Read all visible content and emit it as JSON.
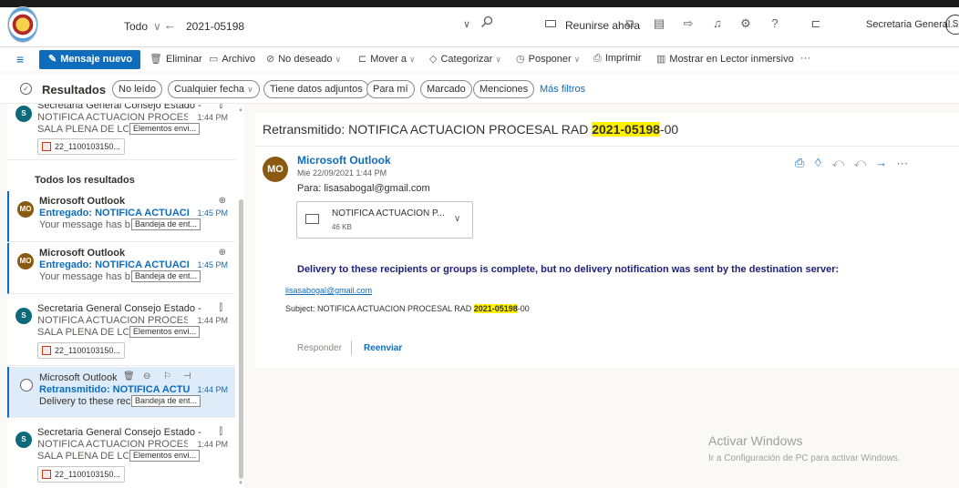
{
  "topbar": {
    "scope": "Todo",
    "search_query": "2021-05198",
    "meet_label": "Reunirse ahora",
    "account": "Secretaria General...",
    "account_initial": "S"
  },
  "commands": {
    "new_message": "Mensaje nuevo",
    "delete": "Eliminar",
    "archive": "Archivo",
    "junk": "No deseado",
    "move_to": "Mover a",
    "categorize": "Categorizar",
    "snooze": "Posponer",
    "print": "Imprimir",
    "immersive_reader": "Mostrar en Lector inmersivo",
    "more": "···"
  },
  "filters": {
    "results": "Resultados",
    "unread": "No leído",
    "any_date": "Cualquier fecha",
    "has_attachments": "Tiene datos adjuntos",
    "to_me": "Para mí",
    "flagged": "Marcado",
    "mentions": "Menciones",
    "more_filters": "Más filtros"
  },
  "list": {
    "section_all": "Todos los resultados",
    "items": [
      {
        "sender": "Secretaria General Consejo Estado - N...",
        "subject": "NOTIFICA ACTUACION PROCESAL ...",
        "time": "1:44 PM",
        "preview": "SALA PLENA DE LO CON...",
        "folder": "Elementos envi...",
        "attachment": "22_1100103150...",
        "initial": "S"
      },
      {
        "sender": "Microsoft Outlook",
        "subject": "Entregado: NOTIFICA ACTUACIO...",
        "time": "1:45 PM",
        "preview": "Your message has been ...",
        "folder": "Bandeja de ent...",
        "initial": "MO"
      },
      {
        "sender": "Microsoft Outlook",
        "subject": "Entregado: NOTIFICA ACTUACIO...",
        "time": "1:45 PM",
        "preview": "Your message has been ...",
        "folder": "Bandeja de ent...",
        "initial": "MO"
      },
      {
        "sender": "Secretaria General Consejo Estado - N...",
        "subject": "NOTIFICA ACTUACION PROCESAL ...",
        "time": "1:44 PM",
        "preview": "SALA PLENA DE LO CON...",
        "folder": "Elementos envi...",
        "attachment": "22_1100103150...",
        "initial": "S"
      },
      {
        "sender": "Microsoft Outlook",
        "subject": "Retransmitido: NOTIFICA ACTUA...",
        "time": "1:44 PM",
        "preview": "Delivery to these recipien...",
        "folder": "Bandeja de ent..."
      },
      {
        "sender": "Secretaria General Consejo Estado - N...",
        "subject": "NOTIFICA ACTUACION PROCESAL ...",
        "time": "1:44 PM",
        "preview": "SALA PLENA DE LO CON...",
        "folder": "Elementos envi...",
        "attachment": "22_1100103150...",
        "initial": "S"
      }
    ]
  },
  "reading": {
    "title_prefix": "Retransmitido: NOTIFICA ACTUACION PROCESAL RAD ",
    "title_highlight": "2021-05198",
    "title_suffix": "-00",
    "from": "Microsoft Outlook",
    "initials": "MO",
    "date": "Mié 22/09/2021 1:44 PM",
    "to": "Para: lisasabogal@gmail.com",
    "attachment_name": "NOTIFICA ACTUACION P...",
    "attachment_size": "46 KB",
    "body": "Delivery to these recipients or groups is complete, but no delivery notification was sent by the destination server:",
    "recipient_link": "lisasabogal@gmail.com",
    "subject_prefix": "Subject: NOTIFICA ACTUACION PROCESAL RAD ",
    "subject_highlight": "2021-05198",
    "subject_suffix": "-00",
    "reply": "Responder",
    "forward": "Reenviar"
  },
  "watermark": {
    "title": "Activar Windows",
    "subtitle": "Ir a Configuración de PC para activar Windows."
  },
  "colors": {
    "accent": "#0f6cbd",
    "highlight": "#fff100",
    "avatar_s": "#0e6a7a",
    "avatar_mo": "#8b5a12"
  }
}
